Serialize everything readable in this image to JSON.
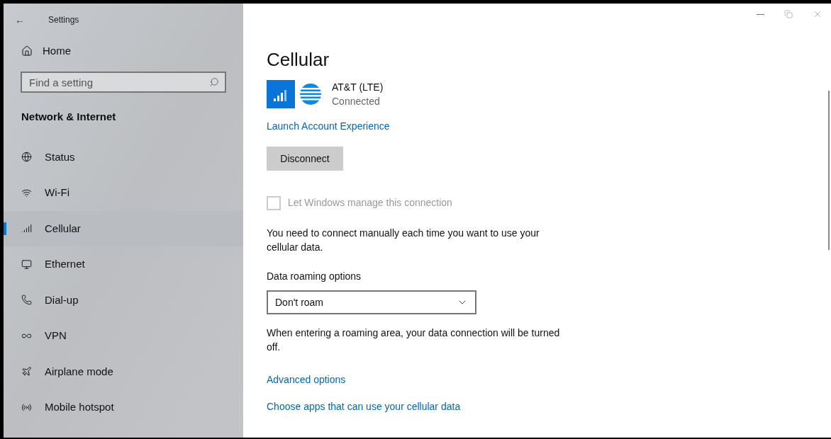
{
  "window": {
    "title": "Settings",
    "back": "←"
  },
  "sidebar": {
    "home": "Home",
    "search": {
      "placeholder": "Find a setting"
    },
    "section": "Network & Internet",
    "items": [
      {
        "label": "Status",
        "selected": false
      },
      {
        "label": "Wi-Fi",
        "selected": false
      },
      {
        "label": "Cellular",
        "selected": true
      },
      {
        "label": "Ethernet",
        "selected": false
      },
      {
        "label": "Dial-up",
        "selected": false
      },
      {
        "label": "VPN",
        "selected": false
      },
      {
        "label": "Airplane mode",
        "selected": false
      },
      {
        "label": "Mobile hotspot",
        "selected": false
      }
    ]
  },
  "page": {
    "title": "Cellular",
    "network": {
      "name": "AT&T (LTE)",
      "status": "Connected"
    },
    "account_link": "Launch Account Experience",
    "disconnect_button": "Disconnect",
    "manage_checkbox": {
      "label": "Let Windows manage this connection",
      "checked": false,
      "disabled": true
    },
    "manual_note": "You need to connect manually each time you want to use your cellular data.",
    "roaming": {
      "label": "Data roaming options",
      "value": "Don't roam"
    },
    "roaming_note": "When entering a roaming area, your data connection will be turned off.",
    "links": [
      "Advanced options",
      "Choose apps that can use your cellular data"
    ]
  }
}
